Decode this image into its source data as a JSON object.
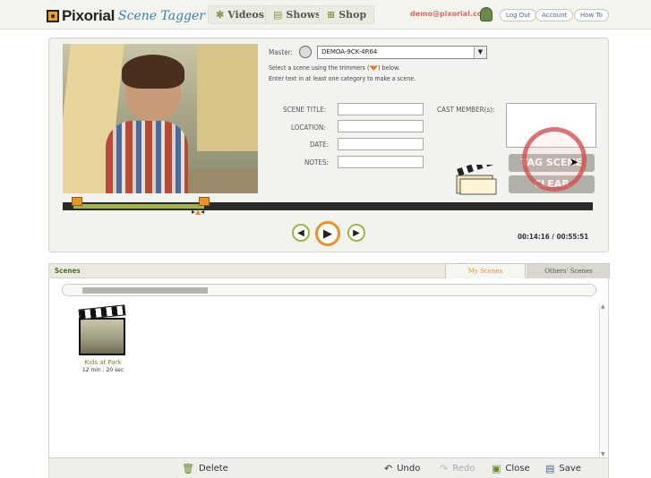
{
  "header": {
    "brand": "Pixorial",
    "product": "Scene Tagger",
    "nav": [
      {
        "label": "Videos",
        "icon": "film-reel-icon"
      },
      {
        "label": "Shows",
        "icon": "film-strip-icon"
      },
      {
        "label": "Shop",
        "icon": "cart-icon"
      }
    ],
    "user_email": "demo@pixorial.com",
    "logout_label": "Log Out",
    "account_label": "Account",
    "howto_label": "How To"
  },
  "editor": {
    "master_label": "Master:",
    "master_value": "DEMOA-9CK-4R64",
    "hint_line1_pre": "Select a scene using the trimmers (",
    "hint_line1_post": ") below.",
    "hint_line2": "Enter text in at least one category to make a scene.",
    "fields": {
      "scene_title_label": "SCENE TITLE:",
      "location_label": "LOCATION:",
      "date_label": "DATE:",
      "notes_label": "NOTES:",
      "cast_label": "CAST MEMBER(s):"
    },
    "tag_scene_label": "TAG SCENE",
    "clear_label": "CLEAR",
    "timecode": "00:14:16 / 00:55:51",
    "trim_start_fraction": 0.02,
    "trim_end_fraction": 0.265
  },
  "scenes": {
    "title": "Scenes",
    "tab_my": "My Scenes",
    "tab_others": "Others' Scenes",
    "items": [
      {
        "name": "Kids at Park",
        "duration": "12 min : 20 sec"
      }
    ],
    "toolbar": {
      "delete_label": "Delete",
      "undo_label": "Undo",
      "redo_label": "Redo",
      "close_label": "Close",
      "save_label": "Save"
    }
  },
  "colors": {
    "accent_orange": "#e6932a",
    "accent_green": "#9fb548",
    "click_ring": "#d24646"
  }
}
